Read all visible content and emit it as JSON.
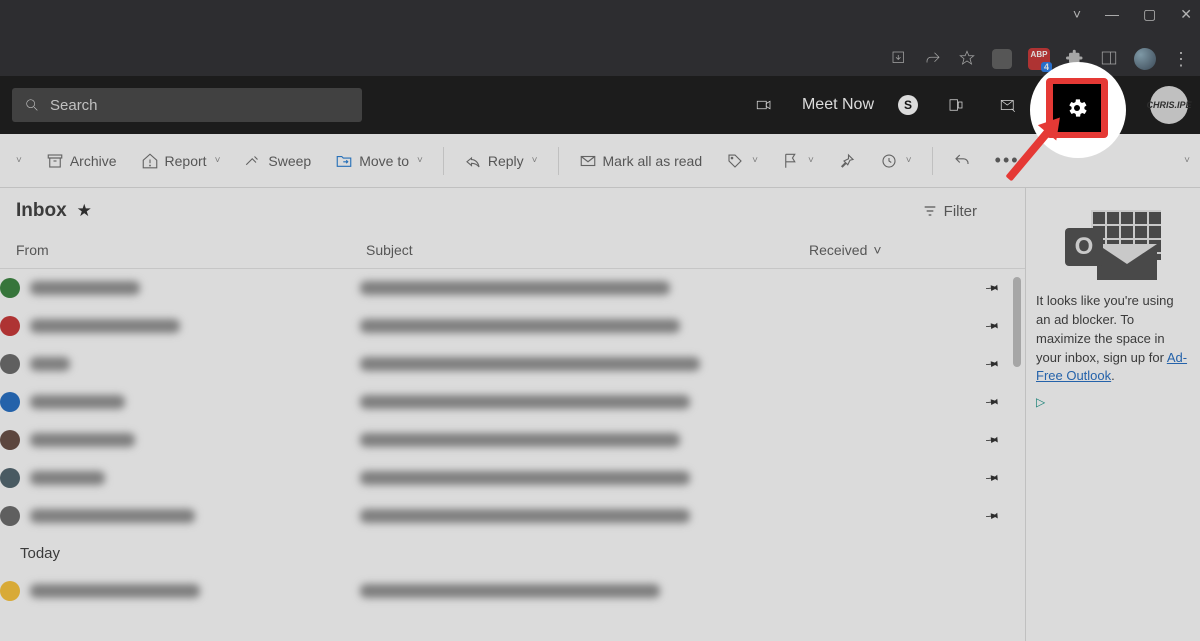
{
  "window": {
    "minimize": "—",
    "maximize": "▢",
    "close": "✕",
    "restore": "˅"
  },
  "browser": {
    "abp_badge": "4",
    "abp_label": "ABP"
  },
  "search": {
    "placeholder": "Search"
  },
  "header": {
    "meet_now": "Meet Now",
    "skype": "S"
  },
  "ribbon": {
    "archive": "Archive",
    "report": "Report",
    "sweep": "Sweep",
    "move_to": "Move to",
    "reply": "Reply",
    "mark_all": "Mark all as read"
  },
  "inbox": {
    "title": "Inbox",
    "filter": "Filter",
    "cols": {
      "from": "From",
      "subject": "Subject",
      "received": "Received"
    },
    "section_today": "Today"
  },
  "rows": [
    {
      "color": "#2e7d32",
      "from_w": 110,
      "subj_w": 310,
      "date_w": 70,
      "pinned": true
    },
    {
      "color": "#c62828",
      "from_w": 150,
      "subj_w": 320,
      "date_w": 55,
      "pinned": true
    },
    {
      "color": "#616161",
      "from_w": 40,
      "subj_w": 340,
      "date_w": 60,
      "pinned": true
    },
    {
      "color": "#1565c0",
      "from_w": 95,
      "subj_w": 330,
      "date_w": 60,
      "pinned": true
    },
    {
      "color": "#5d4037",
      "from_w": 105,
      "subj_w": 320,
      "date_w": 60,
      "pinned": true
    },
    {
      "color": "#455a64",
      "from_w": 75,
      "subj_w": 330,
      "date_w": 60,
      "pinned": true
    },
    {
      "color": "#616161",
      "from_w": 165,
      "subj_w": 330,
      "date_w": 55,
      "pinned": true
    }
  ],
  "today_rows": [
    {
      "color": "#fbc02d",
      "from_w": 170,
      "subj_w": 300,
      "date_w": 45,
      "pinned": false
    }
  ],
  "ad": {
    "text_1": "It looks like you're using an ad blocker. To maximize the space in your inbox, sign up for ",
    "link": "Ad-Free Outlook",
    "text_2": "."
  }
}
